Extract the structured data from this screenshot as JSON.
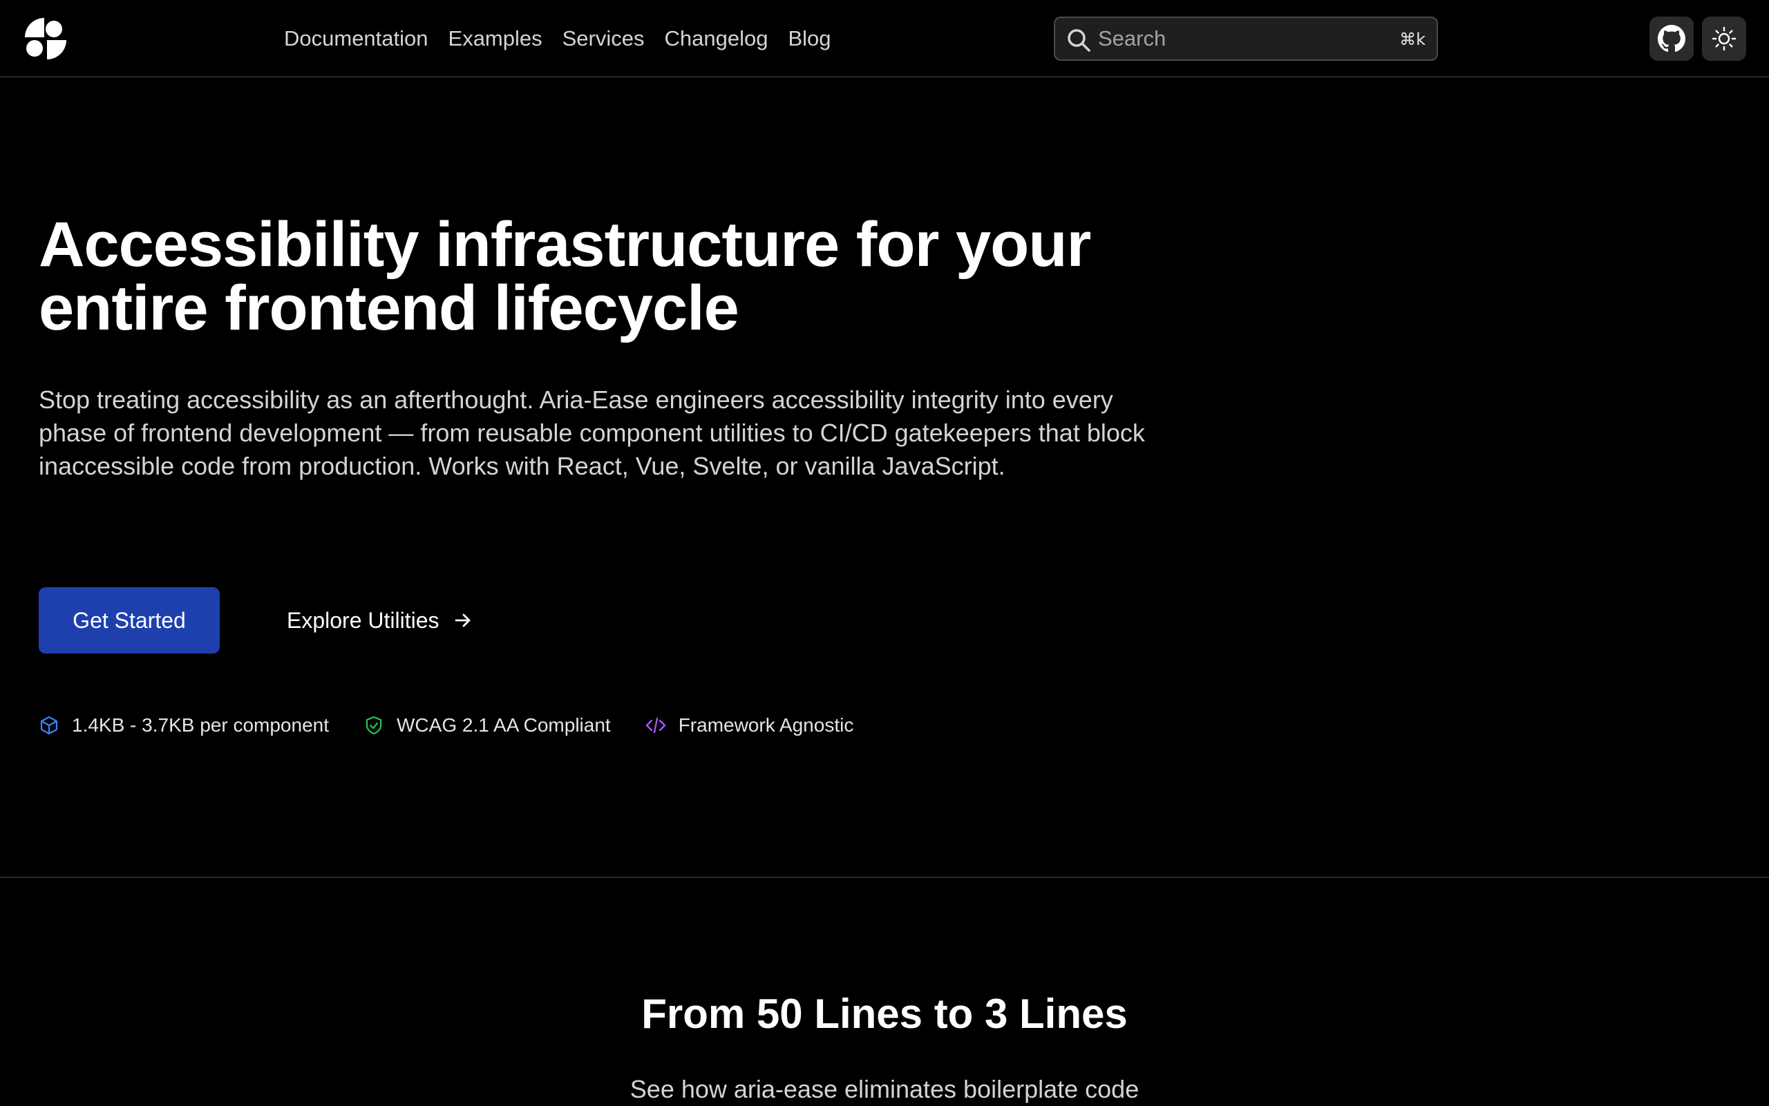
{
  "nav": {
    "logo_icon": "aria-ease-logo-icon",
    "links": [
      "Documentation",
      "Examples",
      "Services",
      "Changelog",
      "Blog"
    ],
    "search": {
      "placeholder": "Search",
      "shortcut": "⌘k",
      "icon": "search-icon"
    },
    "github_icon": "github-icon",
    "theme_icon": "sun-icon"
  },
  "hero": {
    "title_line1": "Accessibility infrastructure for your",
    "title_line2": "entire frontend lifecycle",
    "description": "Stop treating accessibility as an afterthought. Aria-Ease engineers accessibility integrity into every phase of frontend development — from reusable component utilities to CI/CD gatekeepers that block inaccessible code from production. Works with React, Vue, Svelte, or vanilla JavaScript.",
    "primary_button": "Get Started",
    "secondary_button": "Explore Utilities",
    "features": [
      {
        "icon": "cube-icon",
        "label": "1.4KB - 3.7KB per component",
        "color": "#3b82f6"
      },
      {
        "icon": "shield-check-icon",
        "label": "WCAG 2.1 AA Compliant",
        "color": "#22c55e"
      },
      {
        "icon": "code-icon",
        "label": "Framework Agnostic",
        "color": "#a855f7"
      }
    ]
  },
  "section": {
    "title": "From 50 Lines to 3 Lines",
    "subtitle": "See how aria-ease eliminates boilerplate code"
  },
  "colors": {
    "background": "#000000",
    "primary_button": "#1e40af",
    "border": "#2a2a2a"
  }
}
